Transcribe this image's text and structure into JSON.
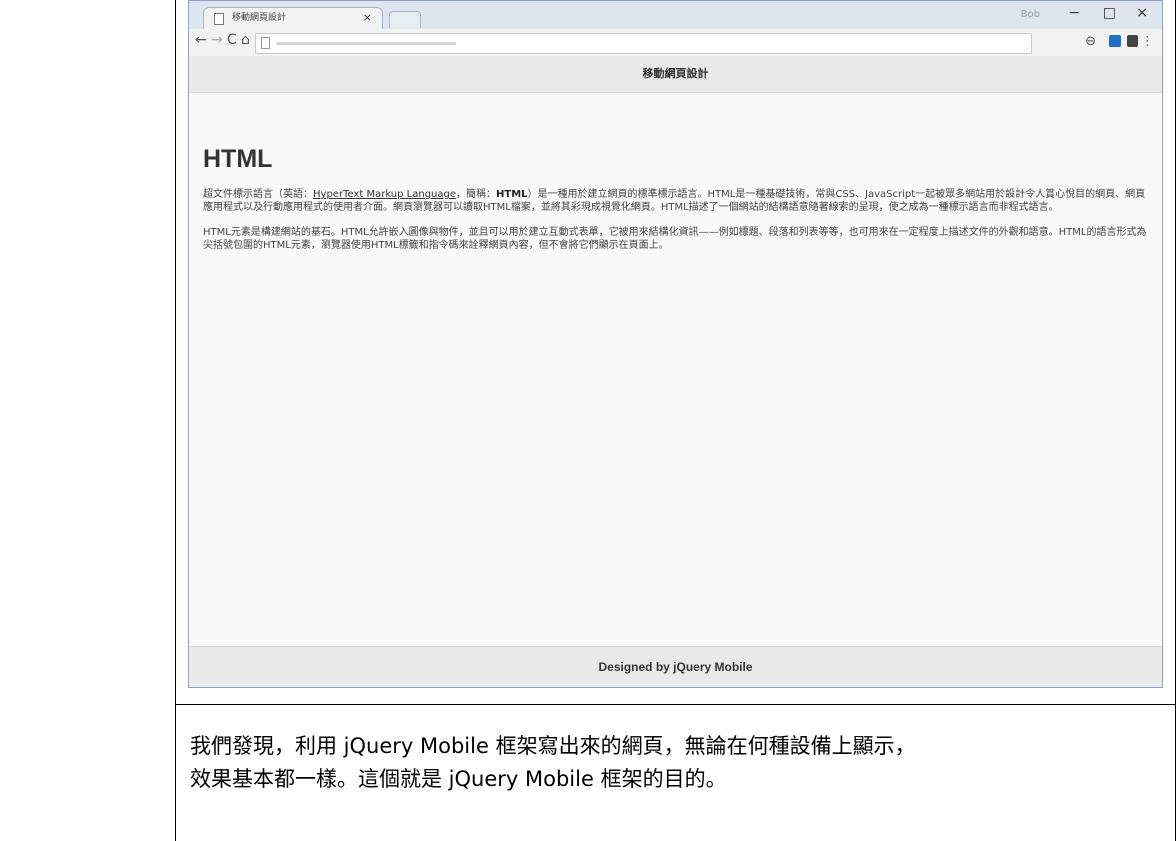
{
  "browser": {
    "tab_title": "移動網頁設計",
    "tab_close": "×",
    "user_label": "Bob",
    "window_controls": {
      "minimize": "−",
      "maximize": "□",
      "close": "×"
    },
    "nav": {
      "back": "←",
      "forward": "→",
      "reload": "C",
      "home": "⌂"
    },
    "toolbar_icons": {
      "zoom": "⊖",
      "menu": "⋮"
    }
  },
  "page": {
    "header_title": "移動網頁設計",
    "heading": "HTML",
    "p1": {
      "before": "超文件標示語言（英語：",
      "link": "HyperText Markup Language",
      "middle": "，簡稱：",
      "abbr": "HTML",
      "after": "）是一種用於建立網頁的標準標示語言。HTML是一種基礎技術，常與CSS、JavaScript一起被眾多網站用於設計令人賞心悅目的網頁、網頁應用程式以及行動應用程式的使用者介面。網頁瀏覽器可以讀取HTML檔案，並將其彩現成視覺化網頁。HTML描述了一個網站的結構語意隨著線索的呈現，使之成為一種標示語言而非程式語言。"
    },
    "p2": "HTML元素是構建網站的基石。HTML允許嵌入圖像與物件，並且可以用於建立互動式表單，它被用來結構化資訊——例如標題、段落和列表等等，也可用來在一定程度上描述文件的外觀和語意。HTML的語言形式為尖括號包圍的HTML元素，瀏覽器使用HTML標籤和指令碼來詮釋網頁內容，但不會將它們顯示在頁面上。",
    "footer": "Designed by jQuery Mobile"
  },
  "caption": {
    "line1": "我們發現，利用 jQuery Mobile 框架寫出來的網頁，無論在何種設備上顯示，",
    "line2": "效果基本都一樣。這個就是 jQuery Mobile 框架的目的。"
  }
}
